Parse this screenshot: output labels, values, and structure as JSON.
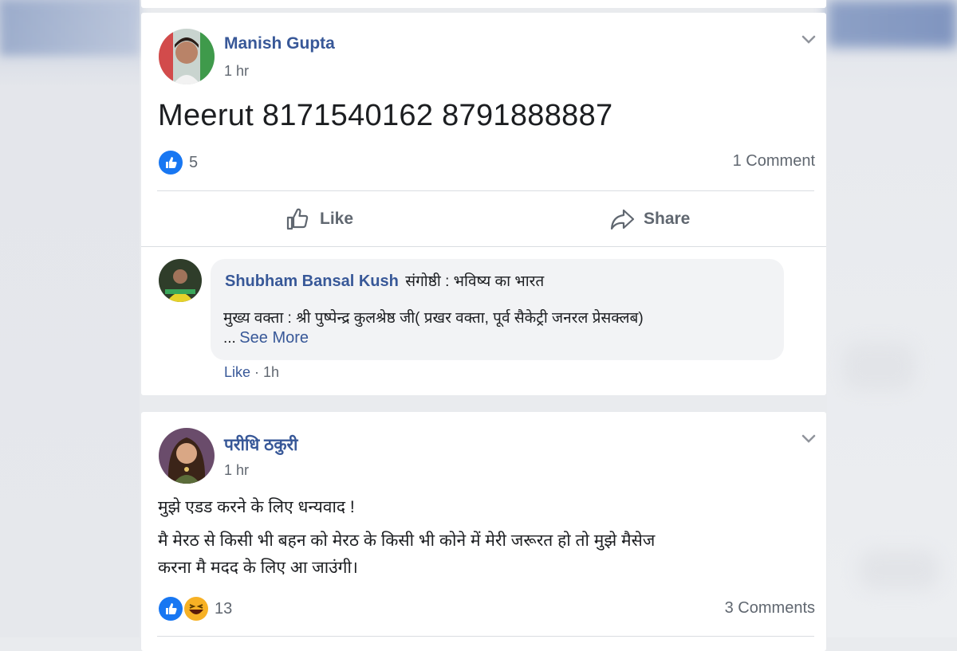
{
  "posts": [
    {
      "author": "Manish Gupta",
      "time": "1 hr",
      "text": "Meerut 8171540162 8791888887",
      "reaction_count": "5",
      "comments_label": "1 Comment",
      "like_label": "Like",
      "share_label": "Share",
      "comment": {
        "author": "Shubham Bansal Kush",
        "text_line1": "संगोष्ठी : भविष्य का भारत",
        "text_line2": "मुख्य वक्ता : श्री पुष्पेन्द्र कुलश्रेष्ठ जी( प्रखर वक्ता, पूर्व सैकेट्री जनरल प्रेसक्लब)",
        "ellipsis": "...",
        "see_more": "See More",
        "like_label": "Like",
        "separator": " · ",
        "time": "1h"
      }
    },
    {
      "author": "परीधि ठकुरी",
      "time": "1 hr",
      "text_line1": "मुझे एडड करने के लिए धन्यवाद !",
      "text_line2": "मै मेरठ से किसी भी बहन को मेरठ के किसी भी कोने में मेरी जरूरत हो तो मुझे मैसेज",
      "text_line3": "करना मै मदद के लिए आ जाउंगी।",
      "reaction_count": "13",
      "comments_label": "3 Comments"
    }
  ],
  "colors": {
    "link": "#385898",
    "like_blue": "#1877f2",
    "secondary_text": "#606770"
  }
}
